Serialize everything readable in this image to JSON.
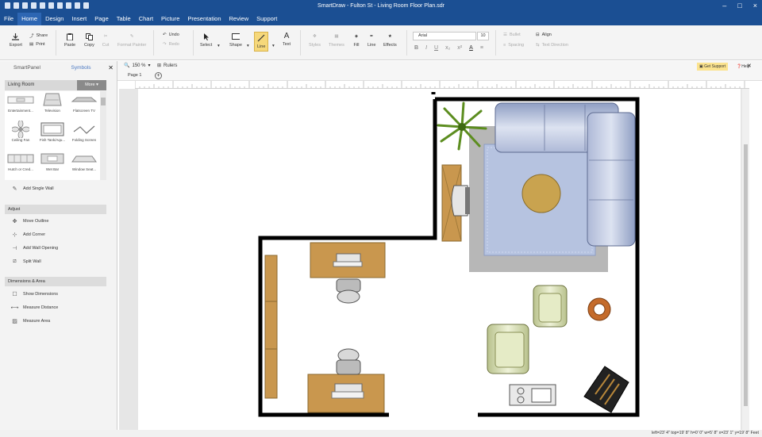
{
  "window": {
    "title": "SmartDraw - Fulton St - Living Room Floor Plan.sdr"
  },
  "menu": [
    "File",
    "Home",
    "Design",
    "Insert",
    "Page",
    "Table",
    "Chart",
    "Picture",
    "Presentation",
    "Review",
    "Support"
  ],
  "ribbon": {
    "export": "Export",
    "share": "Share",
    "print": "Print",
    "paste": "Paste",
    "copy": "Copy",
    "cut": "Cut",
    "format_painter": "Format Painter",
    "undo": "Undo",
    "redo": "Redo",
    "select": "Select",
    "shape": "Shape",
    "line": "Line",
    "text": "Text",
    "styles": "Styles",
    "themes": "Themes",
    "fill": "Fill",
    "line2": "Line",
    "effects": "Effects",
    "font": "Arial",
    "font_size": "10",
    "format_buttons": [
      "B",
      "I",
      "U",
      "x₂",
      "x²",
      "A",
      "≡"
    ],
    "bullet": "Bullet",
    "align": "Align",
    "spacing": "Spacing",
    "text_direction": "Text Direction"
  },
  "panel": {
    "tab_smartpanel": "SmartPanel",
    "tab_symbols": "Symbols",
    "library": "Living Room",
    "more": "More",
    "symbols": [
      "Entertainment...",
      "Television",
      "Flatscreen TV",
      "Ceiling Fan",
      "Fish Tank/Aqu...",
      "Folding Screen",
      "Hutch or Cred...",
      "Wet Bar",
      "Window Seat..."
    ],
    "add_single_wall": "Add Single Wall",
    "adjust_title": "Adjust",
    "adjust": [
      "Move Outline",
      "Add Corner",
      "Add Wall Opening",
      "Split Wall"
    ],
    "dimensions_title": "Dimensions & Area",
    "dimensions": [
      "Show Dimensions",
      "Measure Distance",
      "Measure Area"
    ]
  },
  "toolbar2": {
    "zoom": "150 %",
    "rulers": "Rulers",
    "get_support": "Get Support",
    "help": "Help"
  },
  "pages": {
    "tab": "Page 1",
    "add": "+"
  },
  "status": "left=23' 4\"  top=19' 8\"  h=0' 0\"  w=5' 8\"   x=23' 1\"  y=19' 8\"  Feet",
  "colors": {
    "titlebar": "#1b4f93",
    "menu_active": "#2d66b3",
    "wall": "#000000",
    "wood": "#c9974e",
    "rug": "#b4c0de",
    "sofa": "#b5c3df",
    "armchair": "#d6ddb0"
  }
}
